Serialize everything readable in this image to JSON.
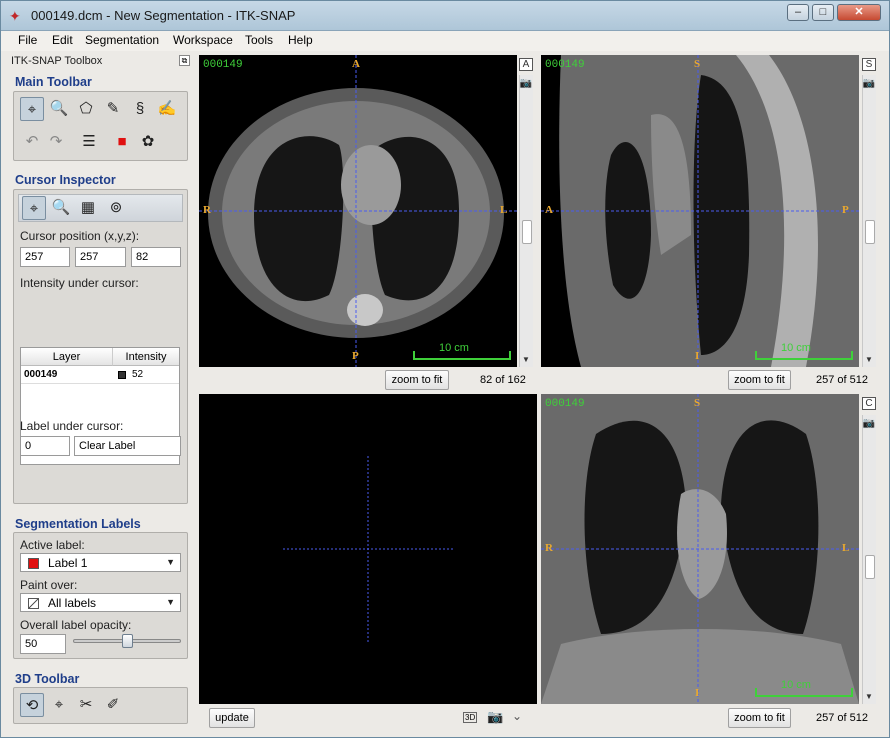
{
  "window": {
    "title": "000149.dcm - New Segmentation - ITK-SNAP",
    "minimize": "–",
    "maximize": "□",
    "close": "✕"
  },
  "menu": [
    "File",
    "Edit",
    "Segmentation",
    "Workspace",
    "Tools",
    "Help"
  ],
  "toolbox": {
    "title": "ITK-SNAP Toolbox",
    "main_toolbar": {
      "title": "Main Toolbar",
      "row1_icons": [
        "crosshair-tool",
        "zoom-pan-tool",
        "polygon-tool",
        "paintbrush-tool",
        "snake-tool",
        "annotation-tool"
      ],
      "row2_icons": [
        "undo",
        "redo",
        "layer-inspector",
        "label-color",
        "palette"
      ]
    },
    "cursor_inspector": {
      "title": "Cursor Inspector",
      "position_label": "Cursor position (x,y,z):",
      "x": "257",
      "y": "257",
      "z": "82",
      "intensity_label": "Intensity under cursor:",
      "columns": [
        "Layer",
        "Intensity"
      ],
      "rows": [
        {
          "layer": "000149",
          "intensity": "52"
        }
      ],
      "label_under_cursor": "Label under cursor:",
      "label_id": "0",
      "label_name": "Clear Label"
    },
    "segmentation_labels": {
      "title": "Segmentation Labels",
      "active_label_text": "Active label:",
      "active_label": "Label 1",
      "active_color": "#e01010",
      "paint_over_text": "Paint over:",
      "paint_over": "All labels",
      "opacity_text": "Overall label opacity:",
      "opacity": "50",
      "opacity_fraction": 0.5
    },
    "toolbar_3d": {
      "title": "3D Toolbar",
      "icons": [
        "rotate-3d",
        "crosshair-3d",
        "scalpel-3d",
        "spray-3d"
      ]
    }
  },
  "views": {
    "axial": {
      "tag": "000149",
      "top": "A",
      "bottom": "P",
      "left": "R",
      "right": "L",
      "scale": "10 cm",
      "zoom": "zoom to fit",
      "slice": "82 of 162",
      "side_letter": "A"
    },
    "sagittal": {
      "tag": "000149",
      "top": "S",
      "bottom": "I",
      "left": "A",
      "right": "P",
      "scale": "10 cm",
      "zoom": "zoom to fit",
      "slice": "257 of 512",
      "side_letter": "S"
    },
    "view3d": {
      "update": "update",
      "btn3d": "3D"
    },
    "coronal": {
      "tag": "000149",
      "top": "S",
      "bottom": "I",
      "left": "R",
      "right": "L",
      "scale": "10 cm",
      "zoom": "zoom to fit",
      "slice": "257 of 512",
      "side_letter": "C"
    }
  },
  "colors": {
    "crosshair": "#4a5cf0",
    "overlay_text": "#3fd03a",
    "orientation": "#e8a830",
    "section_title": "#1f3e8a"
  }
}
